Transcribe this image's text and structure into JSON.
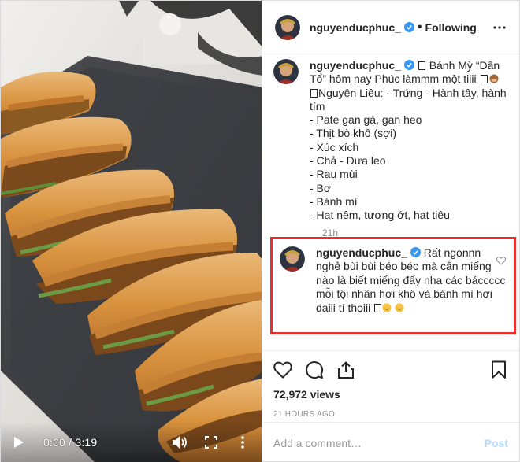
{
  "video": {
    "current_time": "0:00",
    "separator": " / ",
    "duration": "3:19",
    "progress": 0
  },
  "header": {
    "username": "nguyenducphuc_",
    "dot": "•",
    "follow_state": "Following"
  },
  "caption": {
    "username": "nguyenducphuc_",
    "lines": [
      "Bánh Mỳ “Dân Tổ” hôm nay Phúc làmmm một tiiii",
      "",
      "Nguyên Liệu: - Trứng - Hành tây, hành tím",
      "- Pate gan gà, gan heo",
      "- Thịt bò khô (sợi)",
      "- Xúc xích",
      "- Chả - Dưa leo",
      "- Rau mùi",
      "- Bơ",
      "- Bánh mì",
      "- Hạt nêm, tương ớt, hạt tiêu"
    ],
    "time": "21h"
  },
  "comment": {
    "username": "nguyenducphuc_",
    "text": "Rất ngonnn nghẻ bùi bùi béo béo mà cắn miếng nào là biết miếng đấy nha các báccccc mỗi tội nhân hơi khô và bánh mì hơi daiii tí thoiii"
  },
  "stats": {
    "views": "72,972 views",
    "posted": "21 HOURS AGO"
  },
  "add_comment": {
    "placeholder": "Add a comment…",
    "post_label": "Post"
  },
  "colors": {
    "highlight_border": "#e4312f",
    "verified": "#3897f0",
    "post_disabled": "#b3dbff"
  },
  "icons": [
    "play-icon",
    "volume-icon",
    "fullscreen-icon",
    "more-icon",
    "verified-icon",
    "heart-icon",
    "comment-icon",
    "share-icon",
    "bookmark-icon"
  ]
}
